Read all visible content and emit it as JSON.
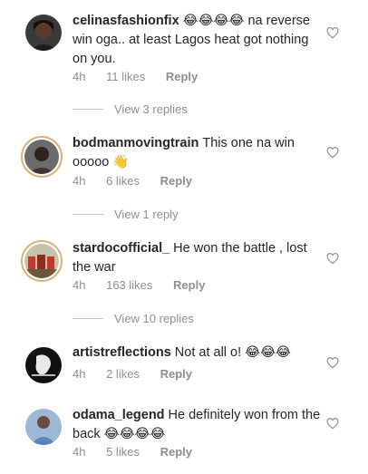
{
  "comments": [
    {
      "username": "celinasfashionfix",
      "text": "😂😂😂😂 na reverse win oga.. at least Lagos heat got nothing on you.",
      "time": "4h",
      "likes": "11 likes",
      "reply": "Reply",
      "view_replies": "View 3 replies"
    },
    {
      "username": "bodmanmovingtrain",
      "text": "This one na win ooooo 👋",
      "time": "4h",
      "likes": "6 likes",
      "reply": "Reply",
      "view_replies": "View 1 reply"
    },
    {
      "username": "stardocofficial_",
      "text": "He won the battle , lost the war",
      "time": "4h",
      "likes": "163 likes",
      "reply": "Reply",
      "view_replies": "View 10 replies"
    },
    {
      "username": "artistreflections",
      "text": "Not at all o! 😂😂😂",
      "time": "4h",
      "likes": "2 likes",
      "reply": "Reply"
    },
    {
      "username": "odama_legend",
      "text": "He definitely won from the back 😂😂😂😂",
      "time": "4h",
      "likes": "5 likes",
      "reply": "Reply"
    }
  ],
  "colors": {
    "text": "#262626",
    "meta": "#8e8e8e",
    "story_ring": "#d8b27a"
  }
}
